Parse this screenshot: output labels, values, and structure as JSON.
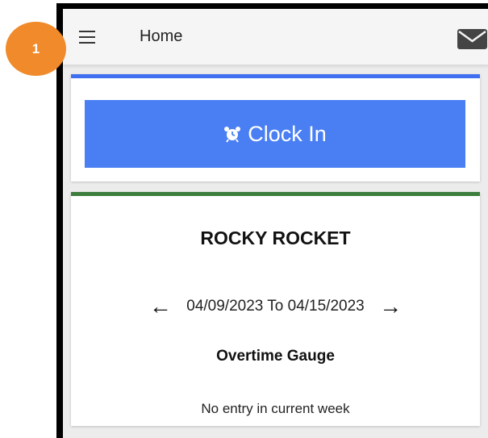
{
  "appbar": {
    "title": "Home",
    "menu_icon": "hamburger-icon",
    "mail_icon": "mail-icon"
  },
  "clock_card": {
    "button_label": "Clock In",
    "button_icon": "alarm-clock-icon",
    "accent_color": "#3f6ff0",
    "button_color": "#4a7ff3"
  },
  "info_card": {
    "employee_name": "ROCKY ROCKET",
    "week_range": "04/09/2023 To 04/15/2023",
    "prev_icon": "arrow-left-icon",
    "next_icon": "arrow-right-icon",
    "gauge_title": "Overtime Gauge",
    "empty_message": "No entry in current week",
    "accent_color": "#3d7d3d"
  },
  "step_badge": {
    "number": "1",
    "color": "#f08a2a"
  }
}
